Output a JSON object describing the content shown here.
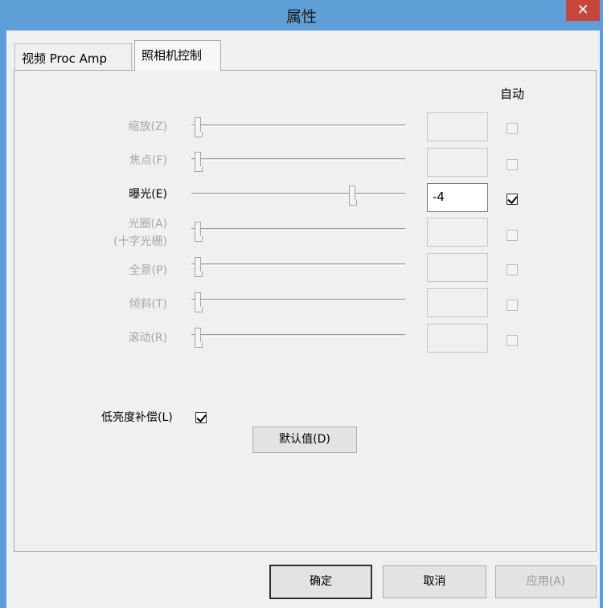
{
  "window": {
    "title": "属性",
    "close_glyph": "✕"
  },
  "tabs": [
    {
      "label": "视频 Proc Amp"
    },
    {
      "label": "照相机控制"
    }
  ],
  "auto_header": "自动",
  "rows": [
    {
      "label": "缩放(Z)",
      "value": "",
      "auto": false,
      "enabled": false
    },
    {
      "label": "焦点(F)",
      "value": "",
      "auto": false,
      "enabled": false
    },
    {
      "label": "曝光(E)",
      "value": "-4",
      "auto": true,
      "enabled": true
    },
    {
      "label": "光圈(A)",
      "label2": "(十字光栅)",
      "value": "",
      "auto": false,
      "enabled": false
    },
    {
      "label": "全景(P)",
      "value": "",
      "auto": false,
      "enabled": false
    },
    {
      "label": "倾斜(T)",
      "value": "",
      "auto": false,
      "enabled": false
    },
    {
      "label": "滚动(R)",
      "value": "",
      "auto": false,
      "enabled": false
    }
  ],
  "low_light": {
    "label": "低亮度补偿(L)",
    "checked": true
  },
  "default_button": "默认值(D)",
  "footer": {
    "ok": "确定",
    "cancel": "取消",
    "apply": "应用(A)"
  }
}
